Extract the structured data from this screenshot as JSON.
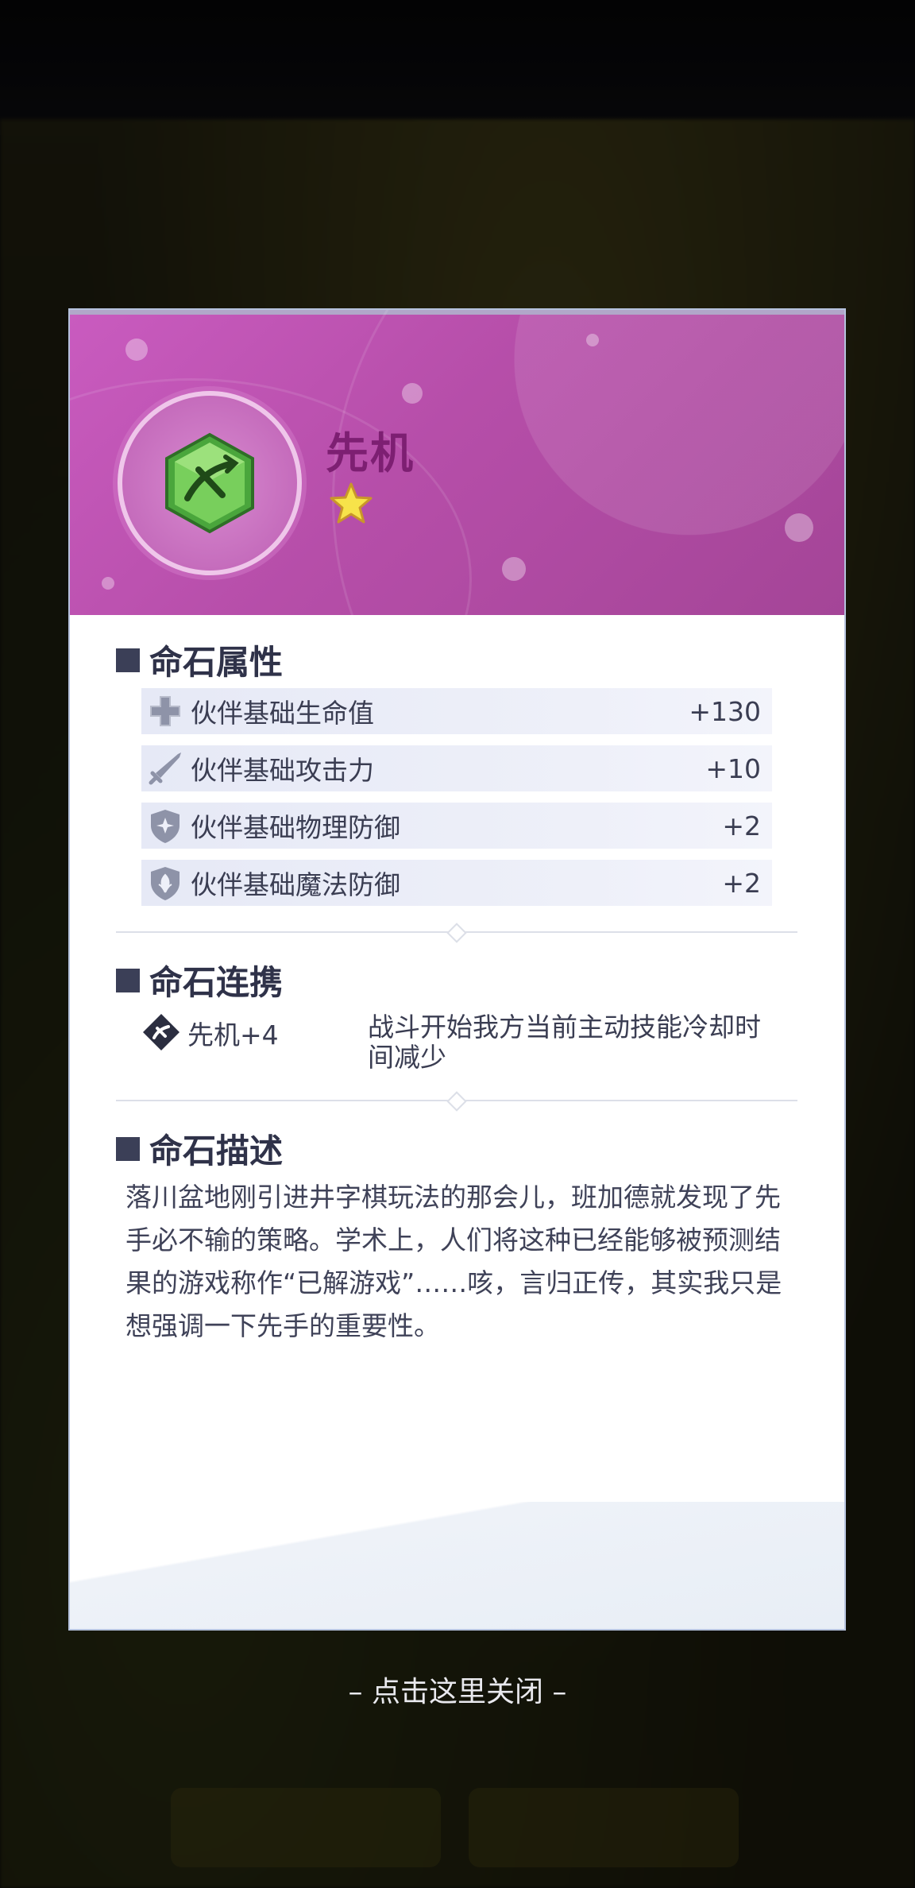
{
  "item": {
    "title": "先机",
    "stars": 1,
    "gem_icon": "green-hexagon-gem-icon"
  },
  "sections": {
    "attributes_title": "命石属性",
    "link_title": "命石连携",
    "description_title": "命石描述"
  },
  "attributes": [
    {
      "icon": "health-cross-icon",
      "name": "伙伴基础生命值",
      "value": "+130"
    },
    {
      "icon": "sword-icon",
      "name": "伙伴基础攻击力",
      "value": "+10"
    },
    {
      "icon": "shield-star-icon",
      "name": "伙伴基础物理防御",
      "value": "+2"
    },
    {
      "icon": "shield-leaf-icon",
      "name": "伙伴基础魔法防御",
      "value": "+2"
    }
  ],
  "link": {
    "name": "先机+4",
    "description": "战斗开始我方当前主动技能冷却时间减少"
  },
  "description": "落川盆地刚引进井字棋玩法的那会儿，班加德就发现了先手必不输的策略。学术上，人们将这种已经能够被预测结果的游戏称作“已解游戏”……咳，言归正传，其实我只是想强调一下先手的重要性。",
  "close_hint": "– 点击这里关闭 –",
  "colors": {
    "header": "#b64ea9",
    "title": "#7d1f72",
    "star": "#f7e34a",
    "gem": "#5fbf4a"
  }
}
